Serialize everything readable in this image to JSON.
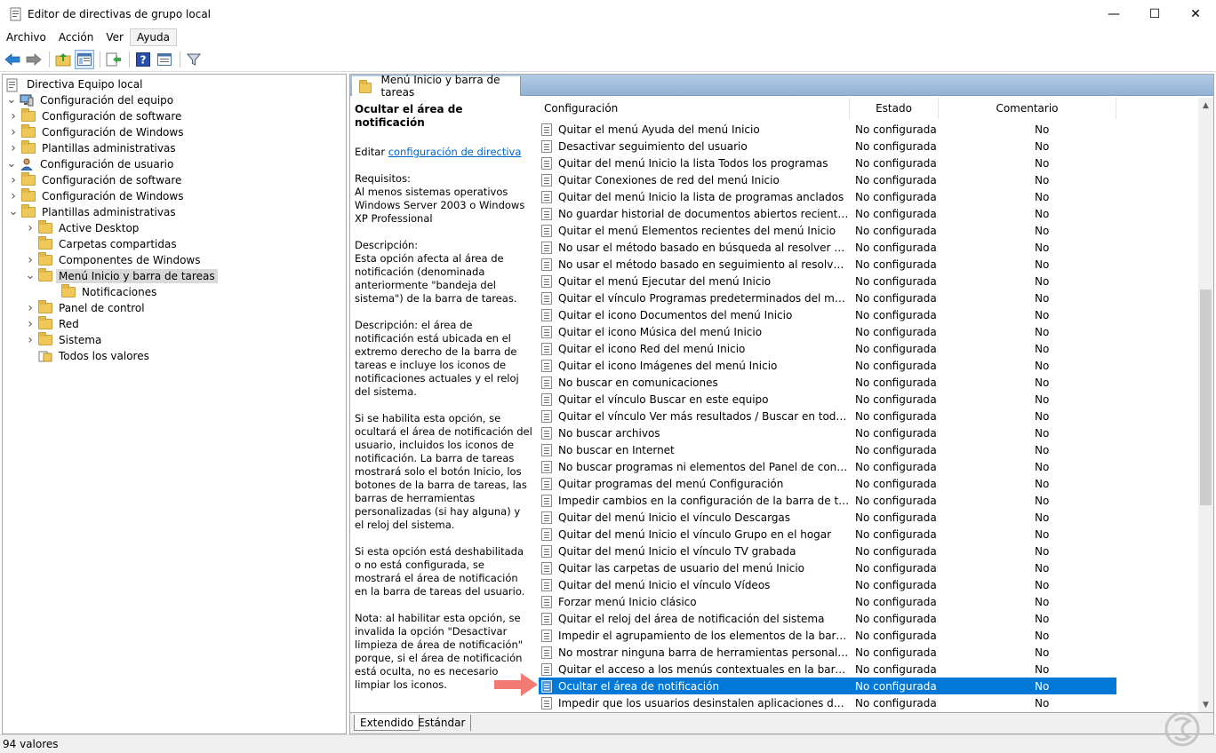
{
  "window": {
    "title": "Editor de directivas de grupo local",
    "minimize": "—",
    "maximize": "☐",
    "close": "✕"
  },
  "menu": [
    "Archivo",
    "Acción",
    "Ver",
    "Ayuda"
  ],
  "tree": [
    {
      "label": "Directiva Equipo local",
      "level": 0,
      "toggle": "",
      "icon": "policy-doc-icon"
    },
    {
      "label": "Configuración del equipo",
      "level": 0,
      "toggle": "v",
      "icon": "computer-icon"
    },
    {
      "label": "Configuración de software",
      "level": 1,
      "toggle": ">",
      "icon": "folder-icon"
    },
    {
      "label": "Configuración de Windows",
      "level": 1,
      "toggle": ">",
      "icon": "folder-icon"
    },
    {
      "label": "Plantillas administrativas",
      "level": 1,
      "toggle": ">",
      "icon": "folder-icon"
    },
    {
      "label": "Configuración de usuario",
      "level": 0,
      "toggle": "v",
      "icon": "user-icon"
    },
    {
      "label": "Configuración de software",
      "level": 1,
      "toggle": ">",
      "icon": "folder-icon"
    },
    {
      "label": "Configuración de Windows",
      "level": 1,
      "toggle": ">",
      "icon": "folder-icon"
    },
    {
      "label": "Plantillas administrativas",
      "level": 1,
      "toggle": "v",
      "icon": "folder-icon"
    },
    {
      "label": "Active Desktop",
      "level": 2,
      "toggle": ">",
      "icon": "folder-icon"
    },
    {
      "label": "Carpetas compartidas",
      "level": 2,
      "toggle": "",
      "icon": "folder-icon"
    },
    {
      "label": "Componentes de Windows",
      "level": 2,
      "toggle": ">",
      "icon": "folder-icon"
    },
    {
      "label": "Menú Inicio y barra de tareas",
      "level": 2,
      "toggle": "v",
      "icon": "folder-icon",
      "selected": true
    },
    {
      "label": "Notificaciones",
      "level": 3,
      "toggle": "",
      "icon": "folder-icon"
    },
    {
      "label": "Panel de control",
      "level": 2,
      "toggle": ">",
      "icon": "folder-icon"
    },
    {
      "label": "Red",
      "level": 2,
      "toggle": ">",
      "icon": "folder-icon"
    },
    {
      "label": "Sistema",
      "level": 2,
      "toggle": ">",
      "icon": "folder-icon"
    },
    {
      "label": "Todos los valores",
      "level": 2,
      "toggle": "",
      "icon": "all-settings-icon"
    }
  ],
  "pane_header": "Menú Inicio y barra de tareas",
  "description": {
    "title": "Ocultar el área de notificación",
    "edit_prefix": "Editar",
    "edit_link": "configuración de directiva",
    "requirements": "Requisitos:\nAl menos sistemas operativos Windows Server 2003 o Windows XP Professional",
    "desc1": "Descripción:\nEsta opción afecta al área de notificación (denominada anteriormente \"bandeja del sistema\") de la barra de tareas.",
    "desc2": "Descripción: el área de notificación está ubicada en el extremo derecho de la barra de tareas e incluye los iconos de notificaciones actuales y el reloj del sistema.",
    "desc3": "Si se habilita esta opción, se ocultará el área de notificación del usuario, incluidos los iconos de notificación. La barra de tareas mostrará solo el botón Inicio, los botones de la barra de tareas, las barras de herramientas personalizadas (si hay alguna) y el reloj del sistema.",
    "desc4": "Si esta opción está deshabilitada o no está configurada, se mostrará el área de notificación en la barra de tareas del usuario.",
    "desc5": "Nota: al habilitar esta opción, se invalida la opción \"Desactivar limpieza de área de notificación\" porque, si el área de notificación está oculta, no es necesario limpiar los iconos."
  },
  "columns": {
    "config": "Configuración",
    "state": "Estado",
    "comment": "Comentario"
  },
  "rows": [
    {
      "name": "Quitar el menú Ayuda del menú Inicio",
      "state": "No configurada",
      "comment": "No"
    },
    {
      "name": "Desactivar seguimiento del usuario",
      "state": "No configurada",
      "comment": "No"
    },
    {
      "name": "Quitar del menú Inicio la lista Todos los programas",
      "state": "No configurada",
      "comment": "No"
    },
    {
      "name": "Quitar Conexiones de red del menú Inicio",
      "state": "No configurada",
      "comment": "No"
    },
    {
      "name": "Quitar del menú Inicio la lista de programas anclados",
      "state": "No configurada",
      "comment": "No"
    },
    {
      "name": "No guardar historial de documentos abiertos recientemente",
      "state": "No configurada",
      "comment": "No"
    },
    {
      "name": "Quitar el menú Elementos recientes del menú Inicio",
      "state": "No configurada",
      "comment": "No"
    },
    {
      "name": "No usar el método basado en búsqueda al resolver accesos ...",
      "state": "No configurada",
      "comment": "No"
    },
    {
      "name": "No usar el método basado en seguimiento al resolver acces...",
      "state": "No configurada",
      "comment": "No"
    },
    {
      "name": "Quitar el menú Ejecutar del menú Inicio",
      "state": "No configurada",
      "comment": "No"
    },
    {
      "name": "Quitar el vínculo Programas predeterminados del menú Inicio",
      "state": "No configurada",
      "comment": "No"
    },
    {
      "name": "Quitar el icono Documentos del menú Inicio",
      "state": "No configurada",
      "comment": "No"
    },
    {
      "name": "Quitar el icono Música del menú Inicio",
      "state": "No configurada",
      "comment": "No"
    },
    {
      "name": "Quitar el icono Red del menú Inicio",
      "state": "No configurada",
      "comment": "No"
    },
    {
      "name": "Quitar el icono Imágenes del menú Inicio",
      "state": "No configurada",
      "comment": "No"
    },
    {
      "name": "No buscar en comunicaciones",
      "state": "No configurada",
      "comment": "No"
    },
    {
      "name": "Quitar el vínculo Buscar en este equipo",
      "state": "No configurada",
      "comment": "No"
    },
    {
      "name": "Quitar el vínculo Ver más resultados / Buscar en todas partes",
      "state": "No configurada",
      "comment": "No"
    },
    {
      "name": "No buscar archivos",
      "state": "No configurada",
      "comment": "No"
    },
    {
      "name": "No buscar en Internet",
      "state": "No configurada",
      "comment": "No"
    },
    {
      "name": "No buscar programas ni elementos del Panel de control",
      "state": "No configurada",
      "comment": "No"
    },
    {
      "name": "Quitar programas del menú Configuración",
      "state": "No configurada",
      "comment": "No"
    },
    {
      "name": "Impedir cambios en la configuración de la barra de tareas y ...",
      "state": "No configurada",
      "comment": "No"
    },
    {
      "name": "Quitar del menú Inicio el vínculo Descargas",
      "state": "No configurada",
      "comment": "No"
    },
    {
      "name": "Quitar del menú Inicio el vínculo Grupo en el hogar",
      "state": "No configurada",
      "comment": "No"
    },
    {
      "name": "Quitar del menú Inicio el vínculo TV grabada",
      "state": "No configurada",
      "comment": "No"
    },
    {
      "name": "Quitar las carpetas de usuario del menú Inicio",
      "state": "No configurada",
      "comment": "No"
    },
    {
      "name": "Quitar del menú Inicio el vínculo Vídeos",
      "state": "No configurada",
      "comment": "No"
    },
    {
      "name": "Forzar menú Inicio clásico",
      "state": "No configurada",
      "comment": "No"
    },
    {
      "name": "Quitar el reloj del área de notificación del sistema",
      "state": "No configurada",
      "comment": "No"
    },
    {
      "name": "Impedir el agrupamiento de los elementos de la barra de tar",
      "state": "No configurada",
      "comment": "No"
    },
    {
      "name": "No mostrar ninguna barra de herramientas personalizada en...",
      "state": "No configurada",
      "comment": "No"
    },
    {
      "name": "Quitar el acceso a los menús contextuales en la barra de tare",
      "state": "No configurada",
      "comment": "No"
    },
    {
      "name": "Ocultar el área de notificación",
      "state": "No configurada",
      "comment": "No",
      "selected": true
    },
    {
      "name": "Impedir que los usuarios desinstalen aplicaciones desde Inicio",
      "state": "No configurada",
      "comment": "No"
    }
  ],
  "bottom_tabs": [
    "Extendido",
    "Estándar"
  ],
  "status": "94 valores",
  "colors": {
    "selection": "#0078d7",
    "header_gradient": "#94b2d4",
    "arrow": "#f37a73"
  }
}
